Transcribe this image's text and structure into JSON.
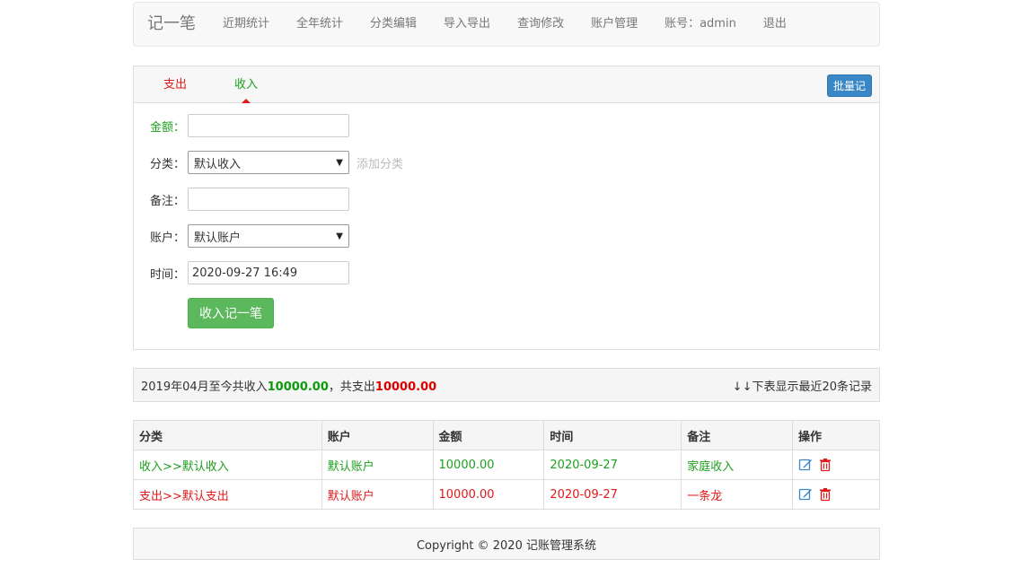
{
  "navbar": {
    "brand": "记一笔",
    "items": [
      "近期统计",
      "全年统计",
      "分类编辑",
      "导入导出",
      "查询修改",
      "账户管理",
      "账号：admin",
      "退出"
    ]
  },
  "tabs": {
    "expense": "支出",
    "income": "收入",
    "active": "income"
  },
  "batch_button": "批量记",
  "form": {
    "amount_label": "金额：",
    "amount_value": "",
    "category_label": "分类：",
    "category_selected": "默认收入",
    "add_category": "添加分类",
    "note_label": "备注：",
    "note_value": "",
    "account_label": "账户：",
    "account_selected": "默认账户",
    "time_label": "时间：",
    "time_value": "2020-09-27 16:49",
    "submit": "收入记一笔"
  },
  "summary": {
    "prefix": "2019年04月至今共收入",
    "income_total": "10000.00",
    "middle": "，共支出",
    "expense_total": "10000.00",
    "note": "↓↓下表显示最近20条记录"
  },
  "table": {
    "headers": [
      "分类",
      "账户",
      "金额",
      "时间",
      "备注",
      "操作"
    ],
    "rows": [
      {
        "type": "income",
        "category": "收入>>默认收入",
        "account": "默认账户",
        "amount": "10000.00",
        "date": "2020-09-27",
        "note": "家庭收入"
      },
      {
        "type": "expense",
        "category": "支出>>默认支出",
        "account": "默认账户",
        "amount": "10000.00",
        "date": "2020-09-27",
        "note": "一条龙"
      }
    ]
  },
  "footer": "Copyright © 2020 记账管理系统",
  "colors": {
    "income": "#1ea01e",
    "expense": "#e0191a",
    "primary": "#3a87c8",
    "success": "#5cb85c"
  }
}
